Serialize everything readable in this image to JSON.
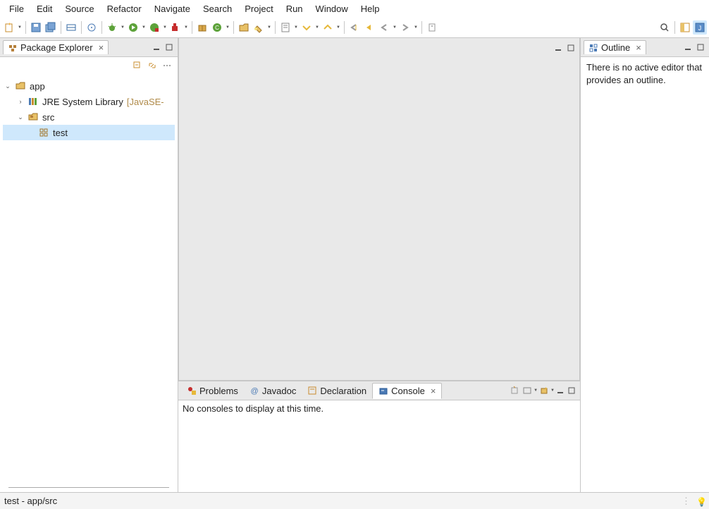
{
  "menu": [
    "File",
    "Edit",
    "Source",
    "Refactor",
    "Navigate",
    "Search",
    "Project",
    "Run",
    "Window",
    "Help"
  ],
  "package_explorer": {
    "title": "Package Explorer",
    "tree": {
      "project": "app",
      "jre": {
        "label": "JRE System Library",
        "suffix": "[JavaSE-"
      },
      "src": "src",
      "pkg": "test"
    }
  },
  "outline": {
    "title": "Outline",
    "message": "There is no active editor that provides an outline."
  },
  "bottom": {
    "tabs": {
      "problems": "Problems",
      "javadoc": "Javadoc",
      "declaration": "Declaration",
      "console": "Console"
    },
    "console_msg": "No consoles to display at this time."
  },
  "status": "test - app/src"
}
